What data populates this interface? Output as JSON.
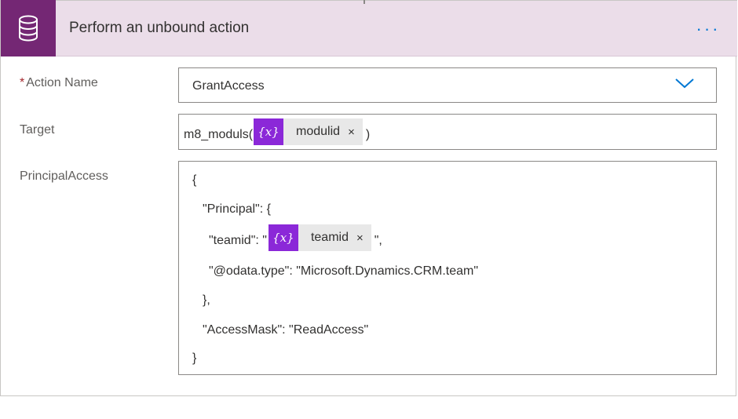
{
  "colors": {
    "header_bg": "#ebdde9",
    "connector_icon_bg": "#742774",
    "variable_token_bg": "#8b28d8",
    "link_blue": "#0078d4",
    "required_red": "#a4262c"
  },
  "header": {
    "icon": "database-icon",
    "title": "Perform an unbound action",
    "more_icon": "ellipsis-icon",
    "more_label": "···"
  },
  "fields": {
    "action_name": {
      "required_mark": "*",
      "label": "Action Name",
      "value": "GrantAccess",
      "dropdown_icon": "chevron-down-icon"
    },
    "target": {
      "label": "Target",
      "prefix": "m8_moduls(",
      "token": {
        "icon": "variable-icon",
        "icon_text": "{x}",
        "label": "modulid",
        "remove": "×"
      },
      "suffix": ")"
    },
    "principal_access": {
      "label": "PrincipalAccess",
      "lines": {
        "l1": "{",
        "l2": "\"Principal\": {",
        "l3_prefix": "\"teamid\": \"",
        "l3_token": {
          "icon": "variable-icon",
          "icon_text": "{x}",
          "label": "teamid",
          "remove": "×"
        },
        "l3_suffix": "\",",
        "l4": "\"@odata.type\": \"Microsoft.Dynamics.CRM.team\"",
        "l5": "},",
        "l6": "\"AccessMask\": \"ReadAccess\"",
        "l7": "}"
      }
    }
  }
}
